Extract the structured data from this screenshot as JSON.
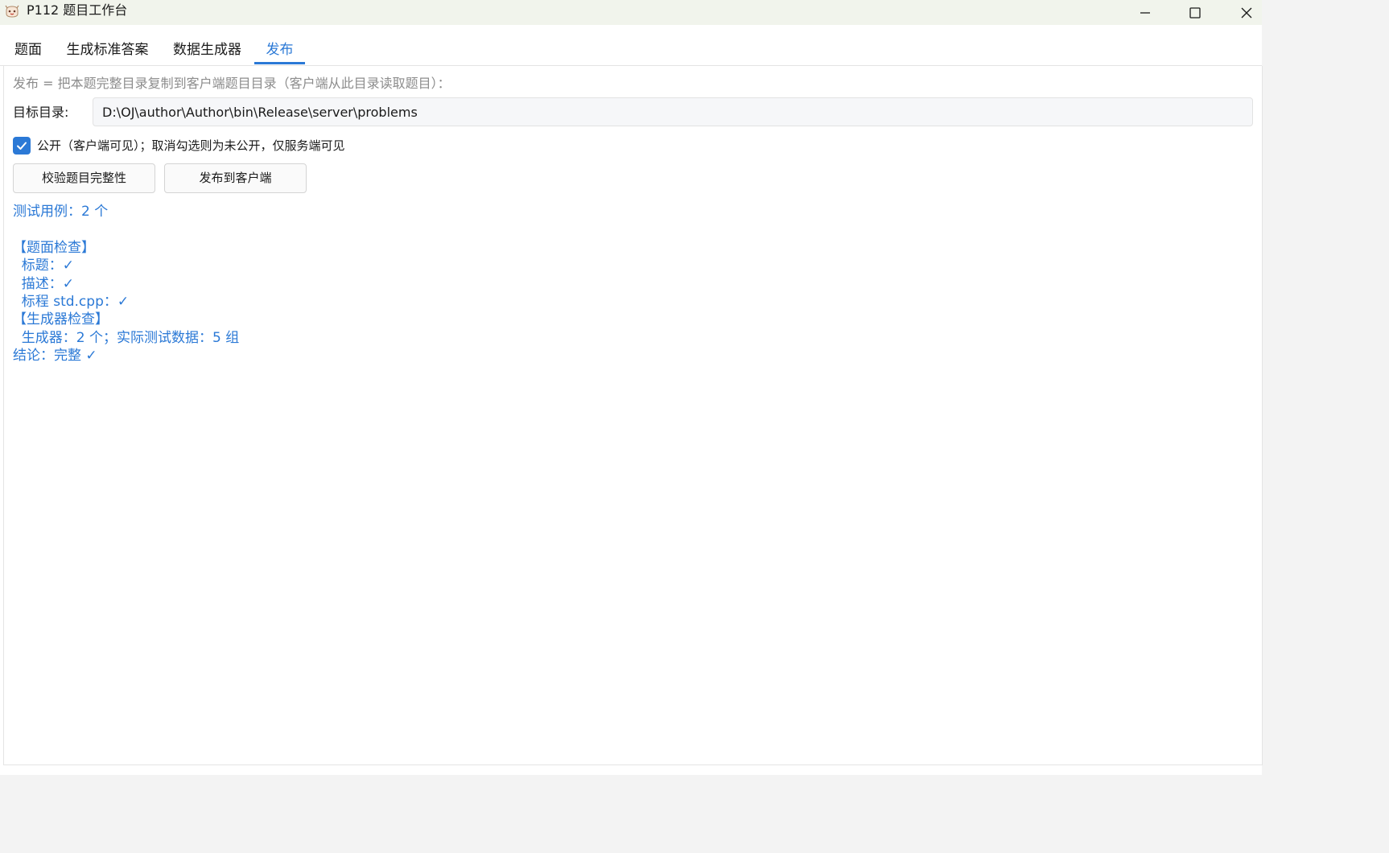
{
  "window": {
    "title": "P112 题目工作台"
  },
  "tabs": [
    {
      "label": "题面"
    },
    {
      "label": "生成标准答案"
    },
    {
      "label": "数据生成器"
    },
    {
      "label": "发布"
    }
  ],
  "active_tab": "发布",
  "publish": {
    "hint": "发布 = 把本题完整目录复制到客户端题目目录（客户端从此目录读取题目）：",
    "target_label": "目标目录:",
    "target_value": "D:\\OJ\\author\\Author\\bin\\Release\\server\\problems",
    "public_checked": true,
    "public_label": "公开（客户端可见）；取消勾选则为未公开，仅服务端可见",
    "validate_button": "校验题目完整性",
    "publish_button": "发布到客户端"
  },
  "result": {
    "test_cases": "测试用例：2 个",
    "lines": [
      "【题面检查】",
      "  标题：✓",
      "  描述：✓",
      "  标程 std.cpp：✓",
      "【生成器检查】",
      "  生成器：2 个；实际测试数据：5 组",
      "结论：完整 ✓"
    ]
  },
  "colors": {
    "accent": "#2b79d6",
    "hint_text": "#8c8c8c",
    "titlebar_bg": "#f1f4ec"
  }
}
